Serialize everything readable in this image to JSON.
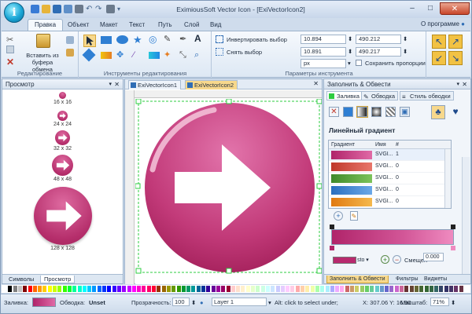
{
  "app": {
    "orb_letter": "i",
    "title": "EximiousSoft Vector Icon - [ExiVectorIcon2]"
  },
  "ribbon_tabs": [
    "Правка",
    "Объект",
    "Макет",
    "Текст",
    "Путь",
    "Слой",
    "Вид"
  ],
  "help_link": "О программе",
  "groups": {
    "editing": {
      "label": "Редактирование",
      "paste_label": "Вставить из буфера обмена"
    },
    "tools": {
      "label": "Инструменты редактирования"
    },
    "params": {
      "label": "Параметры инструмента",
      "invert_selection": "Инвертировать выбор",
      "deselect": "Снять выбор",
      "x": "10.894",
      "y": "10.891",
      "w": "490.212",
      "h": "490.217",
      "unit": "px",
      "keep_ratio": "Сохранить пропорции"
    }
  },
  "left_panel": {
    "title": "Просмотр",
    "previews": [
      "16 x 16",
      "24 x 24",
      "32 x 32",
      "48 x 48",
      "128 x 128"
    ],
    "tabs": [
      "Символы",
      "Просмотр"
    ]
  },
  "doc_tabs": [
    "ExiVectorIcon1",
    "ExiVectorIcon2"
  ],
  "right_panel": {
    "title": "Заполнить & Обвести",
    "tabs": [
      "Заливка",
      "Обводка",
      "Стиль обводки"
    ],
    "gradient_title": "Линейный градиент",
    "table_headers": [
      "Градиент",
      "Имя",
      "#"
    ],
    "rows": [
      {
        "name": "SVGI...",
        "count": "1",
        "color_a": "#b0246a",
        "color_b": "#e06aa6"
      },
      {
        "name": "SVGI...",
        "count": "0",
        "color_a": "#c0392b",
        "color_b": "#e8776b"
      },
      {
        "name": "SVGI...",
        "count": "0",
        "color_a": "#3f8a2a",
        "color_b": "#7cc35a"
      },
      {
        "name": "SVGI...",
        "count": "0",
        "color_a": "#2a6fc0",
        "color_b": "#6aa8e8"
      },
      {
        "name": "SVGI...",
        "count": "0",
        "color_a": "#e07a12",
        "color_b": "#f5b94d"
      }
    ],
    "stop_field": "sto",
    "offset_label": "Смещен",
    "offset_value": "0.000",
    "bottom_tabs": [
      "Заполнить & Обвести",
      "Фильтры",
      "Виджеты"
    ]
  },
  "palette": [
    "#ffffff",
    "#000000",
    "#7f7f7f",
    "#c0c0c0",
    "#800000",
    "#ff0000",
    "#ff6600",
    "#ff9900",
    "#ffcc00",
    "#ffff00",
    "#ccff00",
    "#99ff00",
    "#33ff00",
    "#00ff33",
    "#00ff99",
    "#00ffcc",
    "#00ffff",
    "#00ccff",
    "#0099ff",
    "#0066ff",
    "#0033ff",
    "#0000ff",
    "#3300ff",
    "#6600ff",
    "#9900ff",
    "#cc00ff",
    "#ff00ff",
    "#ff00cc",
    "#ff0099",
    "#ff0066",
    "#ff0033",
    "#993300",
    "#996600",
    "#999900",
    "#669900",
    "#339900",
    "#009933",
    "#009966",
    "#009999",
    "#006699",
    "#003399",
    "#330099",
    "#660099",
    "#990099",
    "#990066",
    "#990033",
    "#ffcccc",
    "#ffe0cc",
    "#fff0cc",
    "#ffffcc",
    "#e5ffcc",
    "#ccffcc",
    "#ccffe5",
    "#ccffff",
    "#cce5ff",
    "#ccccff",
    "#e5ccff",
    "#ffccff",
    "#ffcce5",
    "#ffaaaa",
    "#ffd0aa",
    "#ffeeaa",
    "#eeffaa",
    "#aaffaa",
    "#aaffee",
    "#aaeeff",
    "#aaaaff",
    "#eeaaff",
    "#ffaaee",
    "#cc6666",
    "#cc9966",
    "#cccc66",
    "#99cc66",
    "#66cc66",
    "#66cc99",
    "#66cccc",
    "#6699cc",
    "#6666cc",
    "#9966cc",
    "#cc66cc",
    "#cc6699",
    "#663333",
    "#664433",
    "#666633",
    "#446633",
    "#336633",
    "#336644",
    "#336666",
    "#334466",
    "#333366",
    "#443366",
    "#663366",
    "#663344"
  ],
  "status": {
    "fill_label": "Заливка:",
    "stroke_label": "Обводка:",
    "stroke_value": "Unset",
    "opacity_label": "Прозрачность:",
    "opacity_value": "100",
    "layer": "Layer 1",
    "hint": "Alt: click to select under;",
    "coords": "X: 307.06 Y: 16.90",
    "zoom_label": "Масштаб:",
    "zoom_value": "71%"
  },
  "accent": "#b52e6b"
}
